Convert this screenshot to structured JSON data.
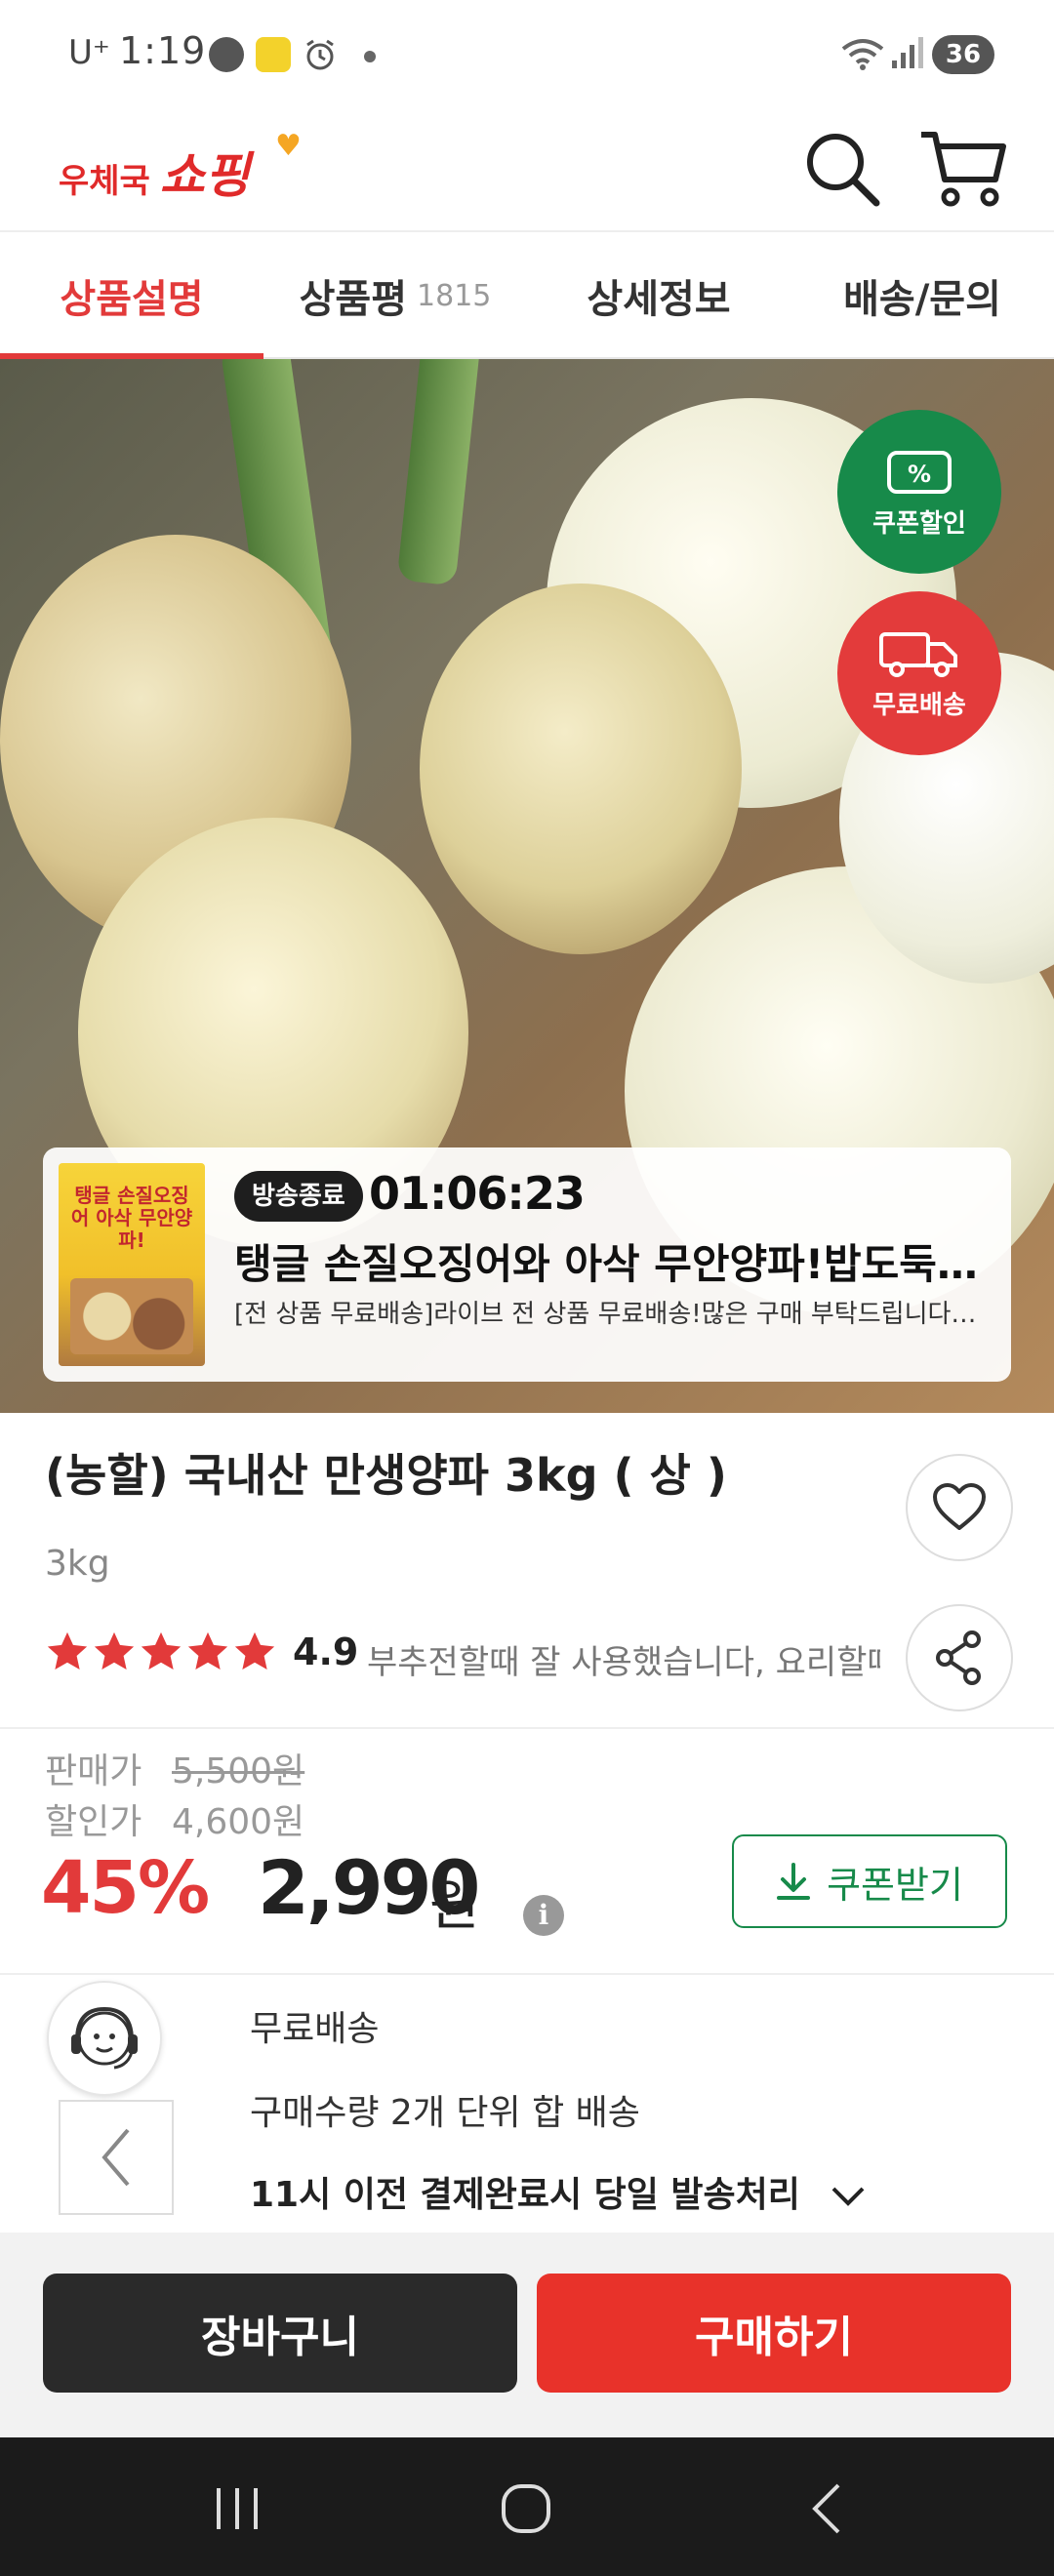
{
  "status_bar": {
    "carrier": "U⁺",
    "time": "1:19",
    "battery": "36"
  },
  "header": {
    "logo_prefix": "우체국",
    "logo_main": "쇼핑"
  },
  "tabs": [
    {
      "label": "상품설명",
      "active": true
    },
    {
      "label": "상품평",
      "count": "1815"
    },
    {
      "label": "상세정보"
    },
    {
      "label": "배송/문의"
    }
  ],
  "badges": {
    "coupon": "쿠폰할인",
    "free_shipping": "무료배송"
  },
  "live": {
    "thumb_text": "탱글 손질오징어 아삭 무안양파!",
    "status": "방송종료",
    "time": "01:06:23",
    "title": "탱글 손질오징어와 아삭 무안양파!밥도둑…",
    "desc": "[전 상품 무료배송]라이브 전 상품 무료배송!많은 구매 부탁드립니다😊[…"
  },
  "product": {
    "name": "(농할) 국내산 만생양파 3kg ( 상 )",
    "weight": "3kg",
    "rating_value": 4.9,
    "rating_text": "4.9",
    "stars": 5,
    "review_snippet": "부추전할때 잘 사용했습니다, 요리할때"
  },
  "price": {
    "sale_label": "판매가",
    "sale_price": "5,500원",
    "discount_label": "할인가",
    "discount_price": "4,600원",
    "discount_percent": "45%",
    "final_price": "2,990",
    "final_unit": "원",
    "coupon_button": "쿠폰받기"
  },
  "delivery": {
    "line1": "무료배송",
    "line2": "구매수량 2개 단위 합 배송",
    "line3": "11시 이전 결제완료시 당일 발송처리"
  },
  "actions": {
    "cart": "장바구니",
    "buy": "구매하기"
  },
  "colors": {
    "accent_red": "#e23a3a",
    "green": "#178a4a",
    "buy_red": "#e8322a",
    "dark": "#2a2a2a"
  }
}
